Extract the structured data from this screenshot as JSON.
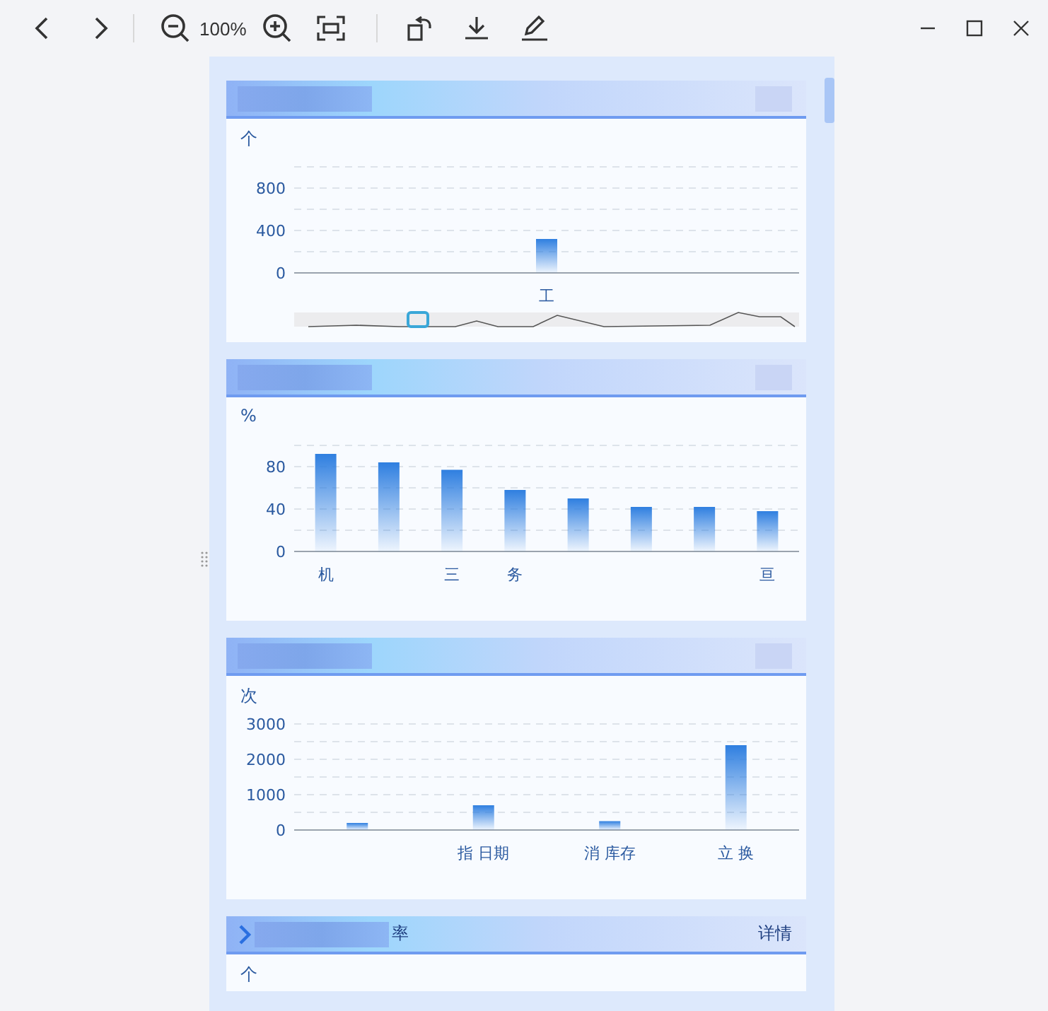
{
  "toolbar": {
    "zoom": "100%"
  },
  "sections": [
    {
      "unit": "个",
      "zoom_slider": true,
      "chart_data": {
        "type": "bar",
        "categories": [
          "工"
        ],
        "values": [
          320
        ],
        "ylim": [
          0,
          1000
        ],
        "yticks": [
          0,
          400,
          800
        ]
      }
    },
    {
      "unit": "%",
      "chart_data": {
        "type": "bar",
        "categories": [
          "机",
          null,
          "三",
          "务",
          null,
          null,
          null,
          "亘"
        ],
        "values": [
          92,
          84,
          77,
          58,
          50,
          42,
          42,
          38
        ],
        "ylim": [
          0,
          100
        ],
        "yticks": [
          0,
          40,
          80
        ]
      }
    },
    {
      "unit": "次",
      "chart_data": {
        "type": "bar",
        "categories": [
          null,
          "指 日期",
          "消 库存",
          "立 换"
        ],
        "values": [
          200,
          700,
          250,
          2400
        ],
        "ylim": [
          0,
          3000
        ],
        "yticks": [
          0,
          1000,
          2000,
          3000
        ]
      }
    },
    {
      "title": "率",
      "link": "详情",
      "unit": "个"
    }
  ]
}
